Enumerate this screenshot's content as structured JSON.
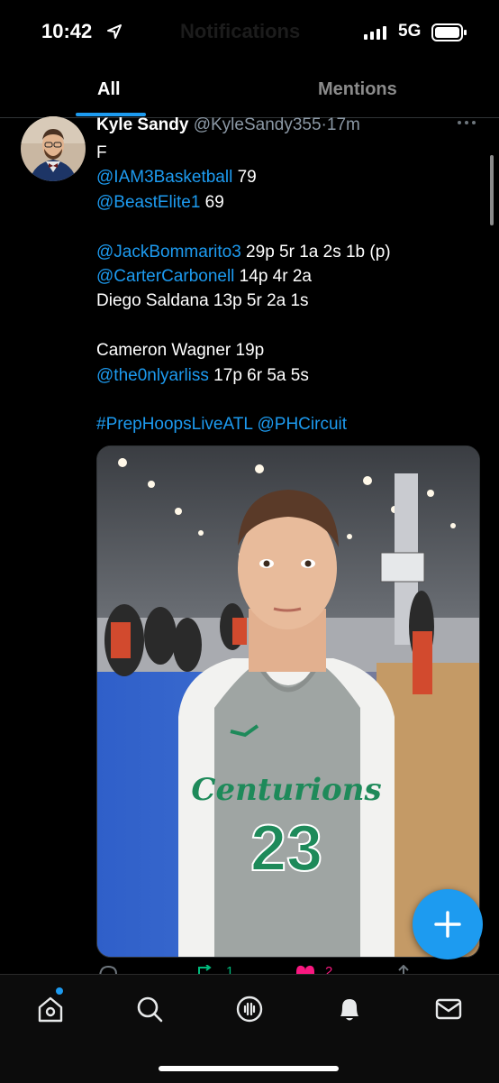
{
  "status_bar": {
    "time": "10:42",
    "background_title": "Notifications",
    "network": "5G"
  },
  "tabs": [
    {
      "label": "All",
      "selected": true
    },
    {
      "label": "Mentions",
      "selected": false
    }
  ],
  "tweet": {
    "author_name": "Kyle Sandy",
    "handle": "@KyleSandy355",
    "separator": "·",
    "time_ago": "17m",
    "lines": [
      {
        "text": "F"
      },
      {
        "mention": "@IAM3Basketball",
        "text": " 79"
      },
      {
        "mention": "@BeastElite1",
        "text": " 69"
      },
      {
        "text": ""
      },
      {
        "mention": "@JackBommarito3",
        "text": " 29p 5r 1a 2s 1b (p)"
      },
      {
        "mention": "@CarterCarbonell",
        "text": " 14p 4r 2a"
      },
      {
        "text": "Diego Saldana 13p 5r 2a 1s"
      },
      {
        "text": ""
      },
      {
        "text": "Cameron Wagner 19p"
      },
      {
        "mention": "@the0nlyarliss",
        "text": " 17p 6r 5a 5s"
      },
      {
        "text": ""
      },
      {
        "mention": "#PrepHoopsLiveATL @PHCircuit",
        "text": ""
      }
    ],
    "photo": {
      "jersey_team": "Centurions",
      "jersey_number": "23"
    },
    "actions": {
      "reply_icon": "reply-icon",
      "retweet_icon": "retweet-icon",
      "retweet_count": "1",
      "like_icon": "heart-icon",
      "like_count": "2",
      "share_icon": "share-icon"
    }
  },
  "fab": {
    "icon": "plus-icon"
  },
  "bottom_nav": [
    {
      "icon": "home-icon",
      "badge": true
    },
    {
      "icon": "search-icon"
    },
    {
      "icon": "spaces-icon"
    },
    {
      "icon": "bell-icon",
      "active": true
    },
    {
      "icon": "mail-icon"
    }
  ],
  "colors": {
    "accent": "#1d9bf0",
    "retweet": "#00ba7c",
    "like": "#f91880",
    "background": "#000000"
  }
}
